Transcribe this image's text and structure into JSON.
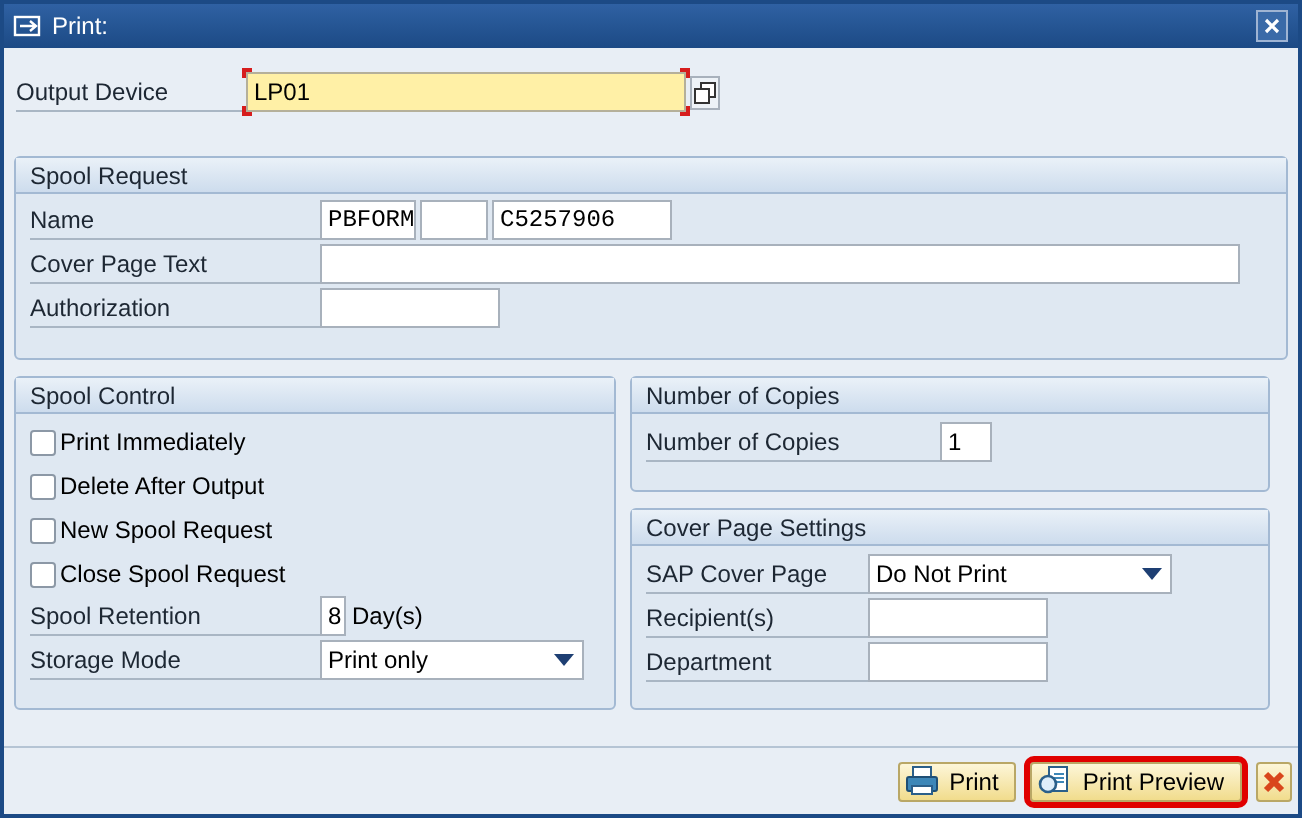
{
  "window": {
    "title": "Print:"
  },
  "output_device": {
    "label": "Output Device",
    "value": "LP01",
    "required": true
  },
  "spool_request": {
    "title": "Spool Request",
    "name": {
      "label": "Name",
      "value_1": "PBFORM",
      "value_3": "C5257906"
    },
    "cover_page_text": {
      "label": "Cover Page Text"
    },
    "authorization": {
      "label": "Authorization"
    }
  },
  "spool_control": {
    "title": "Spool Control",
    "checkboxes": [
      {
        "label": "Print Immediately",
        "checked": false
      },
      {
        "label": "Delete After Output",
        "checked": false
      },
      {
        "label": "New Spool Request",
        "checked": false
      },
      {
        "label": "Close Spool Request",
        "checked": false
      }
    ],
    "retention": {
      "label": "Spool Retention",
      "value": "8",
      "unit": "Day(s)"
    },
    "storage_mode": {
      "label": "Storage Mode",
      "value": "Print only"
    }
  },
  "number_of_copies": {
    "title": "Number of Copies",
    "label": "Number of Copies",
    "value": "1"
  },
  "cover_page_settings": {
    "title": "Cover Page Settings",
    "sap_cover_page": {
      "label": "SAP Cover Page",
      "value": "Do Not Print"
    },
    "recipients": {
      "label": "Recipient(s)"
    },
    "department": {
      "label": "Department"
    }
  },
  "buttons": [
    {
      "kind": "print",
      "label": "Print",
      "highlighted": false
    },
    {
      "kind": "preview",
      "label": "Print Preview",
      "highlighted": true
    },
    {
      "kind": "cancel",
      "highlighted": false
    }
  ]
}
